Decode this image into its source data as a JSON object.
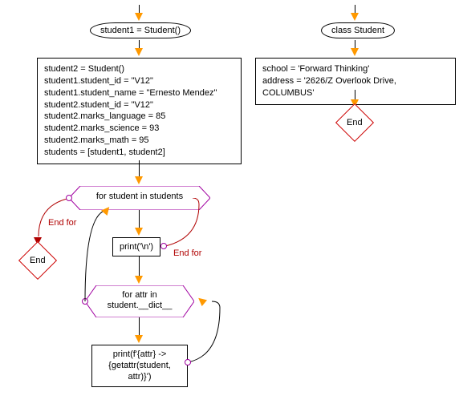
{
  "main": {
    "start_arrow": "start",
    "terminator1": "student1 = Student()",
    "process1": {
      "l1": "student2 = Student()",
      "l2": "student1.student_id = \"V12\"",
      "l3": "student1.student_name = \"Ernesto Mendez\"",
      "l4": "student2.student_id = \"V12\"",
      "l5": "student2.marks_language = 85",
      "l6": "student2.marks_science = 93",
      "l7": "student2.marks_math = 95",
      "l8": "students = [student1, student2]"
    },
    "loop1": "for student in students",
    "endfor1": "End for",
    "end1": "End",
    "print1": "print('\\n')",
    "endfor2": "End for",
    "loop2_l1": "for attr in",
    "loop2_l2": "student.__dict__",
    "print2_l1": "print(f'{attr} ->",
    "print2_l2": "{getattr(student,",
    "print2_l3": "attr)}')"
  },
  "right": {
    "terminator2": "class Student",
    "process2": {
      "l1": "school = 'Forward Thinking'",
      "l2": "address = '2626/Z Overlook Drive, COLUMBUS'"
    },
    "end2": "End"
  },
  "chart_data": {
    "type": "flowchart",
    "left_flow": [
      {
        "id": "start",
        "type": "start-arrow"
      },
      {
        "id": "t1",
        "type": "terminator",
        "text": "student1 = Student()"
      },
      {
        "id": "p1",
        "type": "process",
        "lines": [
          "student2 = Student()",
          "student1.student_id = \"V12\"",
          "student1.student_name = \"Ernesto Mendez\"",
          "student2.student_id = \"V12\"",
          "student2.marks_language = 85",
          "student2.marks_science = 93",
          "student2.marks_math = 95",
          "students = [student1, student2]"
        ]
      },
      {
        "id": "loop1",
        "type": "loop-hexagon",
        "text": "for student in students",
        "exit_label": "End for",
        "exit_to": "end1"
      },
      {
        "id": "end1",
        "type": "end-diamond",
        "text": "End"
      },
      {
        "id": "print1",
        "type": "io",
        "text": "print('\\n')",
        "back_label": "End for"
      },
      {
        "id": "loop2",
        "type": "loop-hexagon",
        "text": "for attr in student.__dict__"
      },
      {
        "id": "print2",
        "type": "io",
        "text": "print(f'{attr} -> {getattr(student, attr)}')"
      }
    ],
    "right_flow": [
      {
        "id": "t2",
        "type": "terminator",
        "text": "class Student"
      },
      {
        "id": "p2",
        "type": "process",
        "lines": [
          "school = 'Forward Thinking'",
          "address = '2626/Z Overlook Drive, COLUMBUS'"
        ]
      },
      {
        "id": "end2",
        "type": "end-diamond",
        "text": "End"
      }
    ],
    "edges": [
      [
        "start",
        "t1"
      ],
      [
        "t1",
        "p1"
      ],
      [
        "p1",
        "loop1"
      ],
      [
        "loop1",
        "print1"
      ],
      [
        "loop1",
        "end1"
      ],
      [
        "print1",
        "loop2"
      ],
      [
        "loop2",
        "print2"
      ],
      [
        "print2",
        "loop2"
      ],
      [
        "print1",
        "loop1"
      ],
      [
        "t2",
        "p2"
      ],
      [
        "p2",
        "end2"
      ]
    ]
  }
}
